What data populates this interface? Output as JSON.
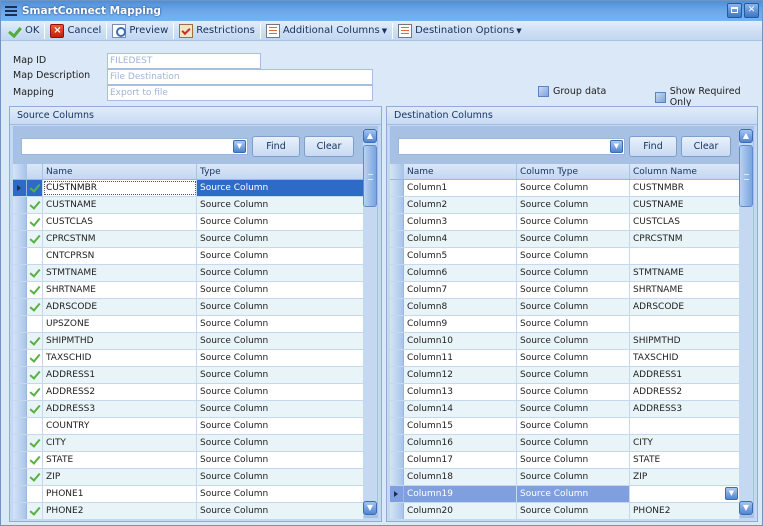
{
  "window": {
    "title": "SmartConnect Mapping",
    "buttons": [
      "restore",
      "close"
    ]
  },
  "toolbar": {
    "ok_label": "OK",
    "cancel_label": "Cancel",
    "preview_label": "Preview",
    "restrictions_label": "Restrictions",
    "additional_columns_label": "Additional Columns",
    "destination_options_label": "Destination Options"
  },
  "form": {
    "map_id_label": "Map ID",
    "map_id_value": "FILEDEST",
    "map_description_label": "Map Description",
    "map_description_value": "File Destination",
    "mapping_label": "Mapping",
    "mapping_value": "Export to file",
    "group_data_label": "Group data",
    "group_data_checked": false,
    "show_required_only_label": "Show Required Only",
    "show_required_only_checked": false
  },
  "source_panel": {
    "title": "Source Columns",
    "search_value": "",
    "find_label": "Find",
    "clear_label": "Clear",
    "columns": [
      "Name",
      "Type"
    ],
    "rows": [
      {
        "mapped": true,
        "name": "CUSTNMBR",
        "type": "Source Column"
      },
      {
        "mapped": true,
        "name": "CUSTNAME",
        "type": "Source Column"
      },
      {
        "mapped": true,
        "name": "CUSTCLAS",
        "type": "Source Column"
      },
      {
        "mapped": true,
        "name": "CPRCSTNM",
        "type": "Source Column"
      },
      {
        "mapped": false,
        "name": "CNTCPRSN",
        "type": "Source Column"
      },
      {
        "mapped": true,
        "name": "STMTNAME",
        "type": "Source Column"
      },
      {
        "mapped": true,
        "name": "SHRTNAME",
        "type": "Source Column"
      },
      {
        "mapped": true,
        "name": "ADRSCODE",
        "type": "Source Column"
      },
      {
        "mapped": false,
        "name": "UPSZONE",
        "type": "Source Column"
      },
      {
        "mapped": true,
        "name": "SHIPMTHD",
        "type": "Source Column"
      },
      {
        "mapped": true,
        "name": "TAXSCHID",
        "type": "Source Column"
      },
      {
        "mapped": true,
        "name": "ADDRESS1",
        "type": "Source Column"
      },
      {
        "mapped": true,
        "name": "ADDRESS2",
        "type": "Source Column"
      },
      {
        "mapped": true,
        "name": "ADDRESS3",
        "type": "Source Column"
      },
      {
        "mapped": false,
        "name": "COUNTRY",
        "type": "Source Column"
      },
      {
        "mapped": true,
        "name": "CITY",
        "type": "Source Column"
      },
      {
        "mapped": true,
        "name": "STATE",
        "type": "Source Column"
      },
      {
        "mapped": true,
        "name": "ZIP",
        "type": "Source Column"
      },
      {
        "mapped": false,
        "name": "PHONE1",
        "type": "Source Column"
      },
      {
        "mapped": true,
        "name": "PHONE2",
        "type": "Source Column"
      }
    ],
    "selected_row": 0
  },
  "destination_panel": {
    "title": "Destination Columns",
    "search_value": "",
    "find_label": "Find",
    "clear_label": "Clear",
    "columns": [
      "Name",
      "Column Type",
      "Column Name"
    ],
    "rows": [
      {
        "name": "Column1",
        "type": "Source Column",
        "column": "CUSTNMBR"
      },
      {
        "name": "Column2",
        "type": "Source Column",
        "column": "CUSTNAME"
      },
      {
        "name": "Column3",
        "type": "Source Column",
        "column": "CUSTCLAS"
      },
      {
        "name": "Column4",
        "type": "Source Column",
        "column": "CPRCSTNM"
      },
      {
        "name": "Column5",
        "type": "Source Column",
        "column": ""
      },
      {
        "name": "Column6",
        "type": "Source Column",
        "column": "STMTNAME"
      },
      {
        "name": "Column7",
        "type": "Source Column",
        "column": "SHRTNAME"
      },
      {
        "name": "Column8",
        "type": "Source Column",
        "column": "ADRSCODE"
      },
      {
        "name": "Column9",
        "type": "Source Column",
        "column": ""
      },
      {
        "name": "Column10",
        "type": "Source Column",
        "column": "SHIPMTHD"
      },
      {
        "name": "Column11",
        "type": "Source Column",
        "column": "TAXSCHID"
      },
      {
        "name": "Column12",
        "type": "Source Column",
        "column": "ADDRESS1"
      },
      {
        "name": "Column13",
        "type": "Source Column",
        "column": "ADDRESS2"
      },
      {
        "name": "Column14",
        "type": "Source Column",
        "column": "ADDRESS3"
      },
      {
        "name": "Column15",
        "type": "Source Column",
        "column": ""
      },
      {
        "name": "Column16",
        "type": "Source Column",
        "column": "CITY"
      },
      {
        "name": "Column17",
        "type": "Source Column",
        "column": "STATE"
      },
      {
        "name": "Column18",
        "type": "Source Column",
        "column": "ZIP"
      },
      {
        "name": "Column19",
        "type": "Source Column",
        "column": ""
      },
      {
        "name": "Column20",
        "type": "Source Column",
        "column": "PHONE2"
      }
    ],
    "selected_row": 18
  }
}
